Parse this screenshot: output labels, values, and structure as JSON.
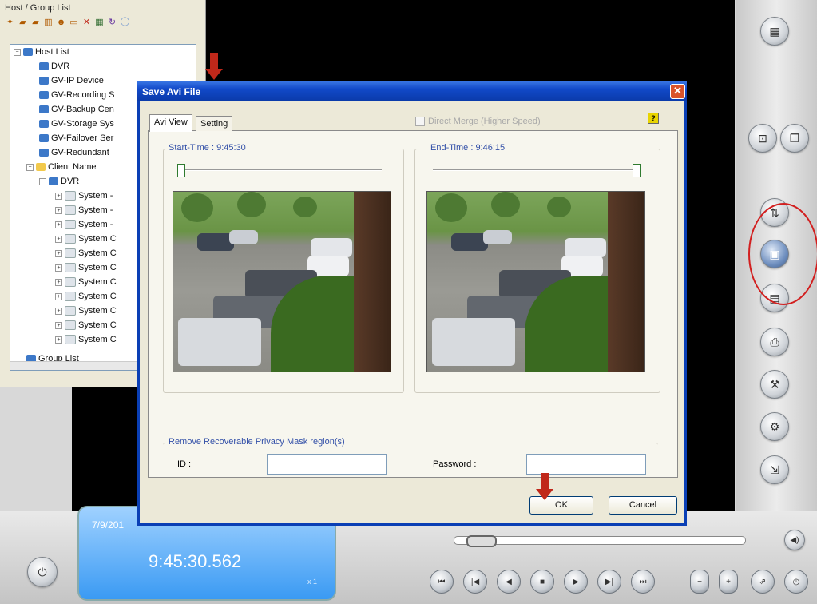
{
  "host_panel": {
    "title": "Host / Group List",
    "tree": [
      {
        "label": "Host List",
        "kind": "root"
      },
      {
        "label": "DVR",
        "kind": "host"
      },
      {
        "label": "GV-IP Device",
        "kind": "host"
      },
      {
        "label": "GV-Recording S",
        "kind": "host"
      },
      {
        "label": "GV-Backup Cen",
        "kind": "host"
      },
      {
        "label": "GV-Storage Sys",
        "kind": "host"
      },
      {
        "label": "GV-Failover Ser",
        "kind": "host"
      },
      {
        "label": "GV-Redundant",
        "kind": "host"
      },
      {
        "label": "Client Name",
        "kind": "folder"
      },
      {
        "label": "DVR",
        "kind": "host"
      },
      {
        "label": "System -",
        "kind": "sys"
      },
      {
        "label": "System -",
        "kind": "sys"
      },
      {
        "label": "System -",
        "kind": "sys"
      },
      {
        "label": "System C",
        "kind": "sys"
      },
      {
        "label": "System C",
        "kind": "sys"
      },
      {
        "label": "System C",
        "kind": "sys"
      },
      {
        "label": "System C",
        "kind": "sys"
      },
      {
        "label": "System C",
        "kind": "sys"
      },
      {
        "label": "System C",
        "kind": "sys"
      },
      {
        "label": "System C",
        "kind": "sys"
      },
      {
        "label": "System C",
        "kind": "sys"
      },
      {
        "label": "Group List",
        "kind": "root"
      }
    ]
  },
  "dialog": {
    "title": "Save Avi File",
    "close_label": "✕",
    "tabs": [
      "Avi View",
      "Setting"
    ],
    "merge_label": "Direct Merge (Higher Speed)",
    "help_label": "?",
    "start_time": "Start-Time : 9:45:30",
    "end_time": "End-Time : 9:46:15",
    "privacy_title": "Remove Recoverable Privacy Mask region(s)",
    "id_label": "ID :",
    "password_label": "Password :",
    "ok_label": "OK",
    "cancel_label": "Cancel"
  },
  "clock": {
    "date": "7/9/201",
    "time": "9:45:30.562",
    "speed": "x 1"
  },
  "playback": {
    "position": 0.05
  },
  "colors": {
    "titlebar": "#0a3fb5",
    "highlight": "#d21f1f",
    "clock": "#3a9af3"
  },
  "icons": {
    "right_panel": [
      "screen-split-icon",
      "zoom-icon",
      "copy-icon",
      "settings-icon",
      "save-icon",
      "backup-icon",
      "print-icon",
      "tools-icon",
      "options-icon",
      "exit-icon"
    ],
    "playback": [
      "rewind-icon",
      "prev-icon",
      "step-back-icon",
      "stop-icon",
      "play-icon",
      "step-forward-icon",
      "fast-forward-icon",
      "slower-icon",
      "faster-icon",
      "export-icon",
      "clock-icon"
    ]
  }
}
